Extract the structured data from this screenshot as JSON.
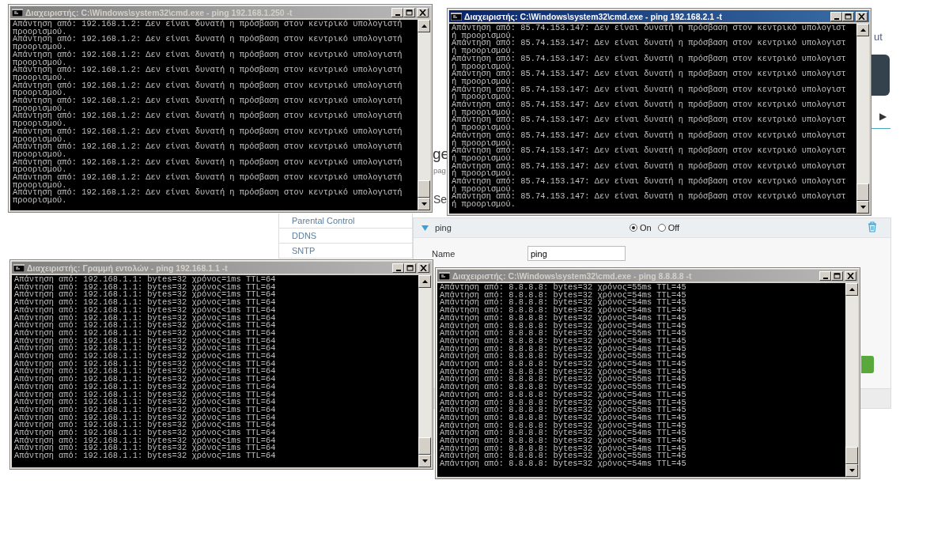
{
  "background_page": {
    "header_link": "ut",
    "tab_arrow": "▶",
    "page_heading": "ge",
    "page_subtitle": "pag",
    "section_heading": "Se",
    "sidebar": {
      "items": [
        {
          "label": "Parental Control"
        },
        {
          "label": "DDNS"
        },
        {
          "label": "SNTP"
        }
      ]
    },
    "rule_panel": {
      "title": "ping",
      "expanded": true,
      "status_options": [
        {
          "label": "On",
          "selected": true
        },
        {
          "label": "Off",
          "selected": false
        }
      ],
      "fields": [
        {
          "label": "Name",
          "value": "ping"
        }
      ]
    }
  },
  "windows": [
    {
      "title": "Διαχειριστής: C:\\Windows\\system32\\cmd.exe - ping  192.168.1.250 -t",
      "active": false,
      "lines": [
        "Απάντηση από: 192.168.1.2: Δεν είναι δυνατή η πρόσβαση στον κεντρικό υπολογιστή",
        "προορισμού.",
        "Απάντηση από: 192.168.1.2: Δεν είναι δυνατή η πρόσβαση στον κεντρικό υπολογιστή",
        "προορισμού.",
        "Απάντηση από: 192.168.1.2: Δεν είναι δυνατή η πρόσβαση στον κεντρικό υπολογιστή",
        "προορισμού.",
        "Απάντηση από: 192.168.1.2: Δεν είναι δυνατή η πρόσβαση στον κεντρικό υπολογιστή",
        "προορισμού.",
        "Απάντηση από: 192.168.1.2: Δεν είναι δυνατή η πρόσβαση στον κεντρικό υπολογιστή",
        "προορισμού.",
        "Απάντηση από: 192.168.1.2: Δεν είναι δυνατή η πρόσβαση στον κεντρικό υπολογιστή",
        "προορισμού.",
        "Απάντηση από: 192.168.1.2: Δεν είναι δυνατή η πρόσβαση στον κεντρικό υπολογιστή",
        "προορισμού.",
        "Απάντηση από: 192.168.1.2: Δεν είναι δυνατή η πρόσβαση στον κεντρικό υπολογιστή",
        "προορισμού.",
        "Απάντηση από: 192.168.1.2: Δεν είναι δυνατή η πρόσβαση στον κεντρικό υπολογιστή",
        "προορισμού.",
        "Απάντηση από: 192.168.1.2: Δεν είναι δυνατή η πρόσβαση στον κεντρικό υπολογιστή",
        "προορισμού.",
        "Απάντηση από: 192.168.1.2: Δεν είναι δυνατή η πρόσβαση στον κεντρικό υπολογιστή",
        "προορισμού.",
        "Απάντηση από: 192.168.1.2: Δεν είναι δυνατή η πρόσβαση στον κεντρικό υπολογιστή",
        "προορισμού."
      ]
    },
    {
      "title": "Διαχειριστής: C:\\Windows\\system32\\cmd.exe - ping  192.168.2.1 -t",
      "active": true,
      "lines": [
        "Απάντηση από: 85.74.153.147: Δεν είναι δυνατή η πρόσβαση στον κεντρικό υπολογιστ",
        "ή προορισμού.",
        "Απάντηση από: 85.74.153.147: Δεν είναι δυνατή η πρόσβαση στον κεντρικό υπολογιστ",
        "ή προορισμού.",
        "Απάντηση από: 85.74.153.147: Δεν είναι δυνατή η πρόσβαση στον κεντρικό υπολογιστ",
        "ή προορισμού.",
        "Απάντηση από: 85.74.153.147: Δεν είναι δυνατή η πρόσβαση στον κεντρικό υπολογιστ",
        "ή προορισμού.",
        "Απάντηση από: 85.74.153.147: Δεν είναι δυνατή η πρόσβαση στον κεντρικό υπολογιστ",
        "ή προορισμού.",
        "Απάντηση από: 85.74.153.147: Δεν είναι δυνατή η πρόσβαση στον κεντρικό υπολογιστ",
        "ή προορισμού.",
        "Απάντηση από: 85.74.153.147: Δεν είναι δυνατή η πρόσβαση στον κεντρικό υπολογιστ",
        "ή προορισμού.",
        "Απάντηση από: 85.74.153.147: Δεν είναι δυνατή η πρόσβαση στον κεντρικό υπολογιστ",
        "ή προορισμού.",
        "Απάντηση από: 85.74.153.147: Δεν είναι δυνατή η πρόσβαση στον κεντρικό υπολογιστ",
        "ή προορισμού.",
        "Απάντηση από: 85.74.153.147: Δεν είναι δυνατή η πρόσβαση στον κεντρικό υπολογιστ",
        "ή προορισμού.",
        "Απάντηση από: 85.74.153.147: Δεν είναι δυνατή η πρόσβαση στον κεντρικό υπολογιστ",
        "ή προορισμού.",
        "Απάντηση από: 85.74.153.147: Δεν είναι δυνατή η πρόσβαση στον κεντρικό υπολογιστ",
        "ή προορισμού."
      ]
    },
    {
      "title": "Διαχειριστής: Γραμμή εντολών - ping  192.168.1.1 -t",
      "active": false,
      "lines": [
        "Απάντηση από: 192.168.1.1: bytes=32 χρόνος=1ms TTL=64",
        "Απάντηση από: 192.168.1.1: bytes=32 χρόνος<1ms TTL=64",
        "Απάντηση από: 192.168.1.1: bytes=32 χρόνος=1ms TTL=64",
        "Απάντηση από: 192.168.1.1: bytes=32 χρόνος=1ms TTL=64",
        "Απάντηση από: 192.168.1.1: bytes=32 χρόνος<1ms TTL=64",
        "Απάντηση από: 192.168.1.1: bytes=32 χρόνος=1ms TTL=64",
        "Απάντηση από: 192.168.1.1: bytes=32 χρόνος<1ms TTL=64",
        "Απάντηση από: 192.168.1.1: bytes=32 χρόνος<1ms TTL=64",
        "Απάντηση από: 192.168.1.1: bytes=32 χρόνος<1ms TTL=64",
        "Απάντηση από: 192.168.1.1: bytes=32 χρόνος=1ms TTL=64",
        "Απάντηση από: 192.168.1.1: bytes=32 χρόνος<1ms TTL=64",
        "Απάντηση από: 192.168.1.1: bytes=32 χρόνος<1ms TTL=64",
        "Απάντηση από: 192.168.1.1: bytes=32 χρόνος=1ms TTL=64",
        "Απάντηση από: 192.168.1.1: bytes=32 χρόνος=1ms TTL=64",
        "Απάντηση από: 192.168.1.1: bytes=32 χρόνος=1ms TTL=64",
        "Απάντηση από: 192.168.1.1: bytes=32 χρόνος=1ms TTL=64",
        "Απάντηση από: 192.168.1.1: bytes=32 χρόνος<1ms TTL=64",
        "Απάντηση από: 192.168.1.1: bytes=32 χρόνος=1ms TTL=64",
        "Απάντηση από: 192.168.1.1: bytes=32 χρόνος=1ms TTL=64",
        "Απάντηση από: 192.168.1.1: bytes=32 χρόνος<1ms TTL=64",
        "Απάντηση από: 192.168.1.1: bytes=32 χρόνος<1ms TTL=64",
        "Απάντηση από: 192.168.1.1: bytes=32 χρόνος<1ms TTL=64",
        "Απάντηση από: 192.168.1.1: bytes=32 χρόνος=1ms TTL=64",
        "Απάντηση από: 192.168.1.1: bytes=32 χρόνος=1ms TTL=64"
      ]
    },
    {
      "title": "Διαχειριστής: C:\\Windows\\system32\\cmd.exe - ping  8.8.8.8 -t",
      "active": false,
      "lines": [
        "Απάντηση από: 8.8.8.8: bytes=32 χρόνος=55ms TTL=45",
        "Απάντηση από: 8.8.8.8: bytes=32 χρόνος=54ms TTL=45",
        "Απάντηση από: 8.8.8.8: bytes=32 χρόνος=54ms TTL=45",
        "Απάντηση από: 8.8.8.8: bytes=32 χρόνος=54ms TTL=45",
        "Απάντηση από: 8.8.8.8: bytes=32 χρόνος=54ms TTL=45",
        "Απάντηση από: 8.8.8.8: bytes=32 χρόνος=54ms TTL=45",
        "Απάντηση από: 8.8.8.8: bytes=32 χρόνος=55ms TTL=45",
        "Απάντηση από: 8.8.8.8: bytes=32 χρόνος=54ms TTL=45",
        "Απάντηση από: 8.8.8.8: bytes=32 χρόνος=54ms TTL=45",
        "Απάντηση από: 8.8.8.8: bytes=32 χρόνος=55ms TTL=45",
        "Απάντηση από: 8.8.8.8: bytes=32 χρόνος=54ms TTL=45",
        "Απάντηση από: 8.8.8.8: bytes=32 χρόνος=54ms TTL=45",
        "Απάντηση από: 8.8.8.8: bytes=32 χρόνος=55ms TTL=45",
        "Απάντηση από: 8.8.8.8: bytes=32 χρόνος=55ms TTL=45",
        "Απάντηση από: 8.8.8.8: bytes=32 χρόνος=54ms TTL=45",
        "Απάντηση από: 8.8.8.8: bytes=32 χρόνος=54ms TTL=45",
        "Απάντηση από: 8.8.8.8: bytes=32 χρόνος=55ms TTL=45",
        "Απάντηση από: 8.8.8.8: bytes=32 χρόνος=54ms TTL=45",
        "Απάντηση από: 8.8.8.8: bytes=32 χρόνος=54ms TTL=45",
        "Απάντηση από: 8.8.8.8: bytes=32 χρόνος=54ms TTL=45",
        "Απάντηση από: 8.8.8.8: bytes=32 χρόνος=54ms TTL=45",
        "Απάντηση από: 8.8.8.8: bytes=32 χρόνος=54ms TTL=45",
        "Απάντηση από: 8.8.8.8: bytes=32 χρόνος=55ms TTL=45",
        "Απάντηση από: 8.8.8.8: bytes=32 χρόνος=54ms TTL=45"
      ]
    }
  ]
}
